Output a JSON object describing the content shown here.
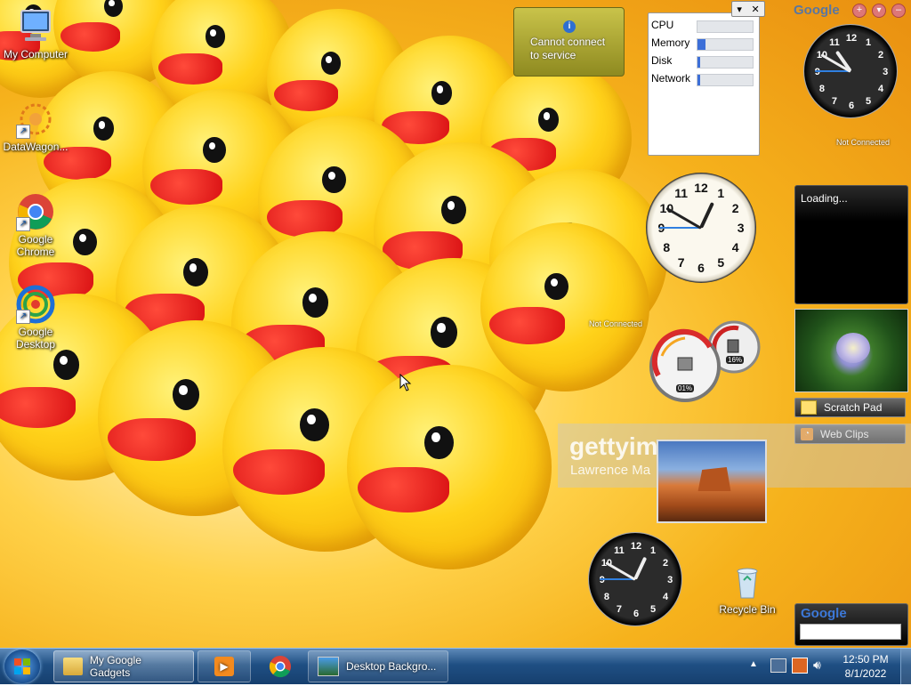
{
  "desktop_icons": [
    {
      "label": "My Computer",
      "icon": "computer-icon",
      "shortcut": false
    },
    {
      "label": "DataWagon...",
      "icon": "datawagon-icon",
      "shortcut": true
    },
    {
      "label": "Google Chrome",
      "icon": "chrome-icon",
      "shortcut": true
    },
    {
      "label": "Google Desktop",
      "icon": "google-desktop-icon",
      "shortcut": true
    },
    {
      "label": "Recycle Bin",
      "icon": "recycle-bin-icon",
      "shortcut": false
    }
  ],
  "weather_gadget": {
    "message": "Cannot connect to service",
    "icon": "info-icon"
  },
  "meter_gadget": {
    "rows": [
      {
        "label": "CPU",
        "level": 0
      },
      {
        "label": "Memory",
        "level": 0.14
      },
      {
        "label": "Disk",
        "level": 0.02
      },
      {
        "label": "Network",
        "level": 0.05
      }
    ]
  },
  "google_header": {
    "logo": "Google",
    "add_icon": "plus-icon",
    "menu_icon": "chevron-down-icon",
    "minimize_icon": "minus-icon"
  },
  "clock_top": {
    "status": "Not Connected",
    "hour": 10,
    "minute": 50,
    "numbers": [
      "12",
      "1",
      "2",
      "3",
      "4",
      "5",
      "6",
      "7",
      "8",
      "9",
      "10",
      "11"
    ]
  },
  "clock_mid": {
    "status": "Not Connected",
    "hour": 12,
    "minute": 50,
    "numbers": [
      "12",
      "1",
      "2",
      "3",
      "4",
      "5",
      "6",
      "7",
      "8",
      "9",
      "10",
      "11"
    ]
  },
  "clock_bottom": {
    "hour": 12,
    "minute": 50,
    "numbers": [
      "12",
      "1",
      "2",
      "3",
      "4",
      "5",
      "6",
      "7",
      "8",
      "9",
      "10",
      "11"
    ]
  },
  "cpu_gauge": {
    "cpu_label": "01%",
    "mem_label": "16%",
    "cpu_level": 0.01,
    "mem_level": 0.16
  },
  "news_gadget": {
    "text": "Loading..."
  },
  "sidebar_buttons": [
    {
      "label": "Scratch Pad",
      "icon": "note-icon"
    },
    {
      "label": "Web Clips",
      "icon": "rss-icon"
    }
  ],
  "watermark": {
    "brand": "gettyimages",
    "photographer": "Lawrence Ma"
  },
  "google_search": {
    "logo": "Google",
    "placeholder": ""
  },
  "taskbar": {
    "start_icon": "windows-logo-icon",
    "items": [
      {
        "label": "My Google Gadgets",
        "icon": "folder-icon",
        "state": "active"
      },
      {
        "label": "",
        "icon": "media-player-icon",
        "state": "running"
      },
      {
        "label": "",
        "icon": "chrome-icon",
        "state": "none"
      },
      {
        "label": "Desktop Backgro...",
        "icon": "desktop-background-icon",
        "state": "running"
      }
    ],
    "tray": {
      "time": "12:50 PM",
      "date": "8/1/2022"
    }
  },
  "colors": {
    "taskbar": "#1f4f83",
    "meter_fill": "#3c6fd8",
    "accent_blue": "#2f7fe0"
  }
}
